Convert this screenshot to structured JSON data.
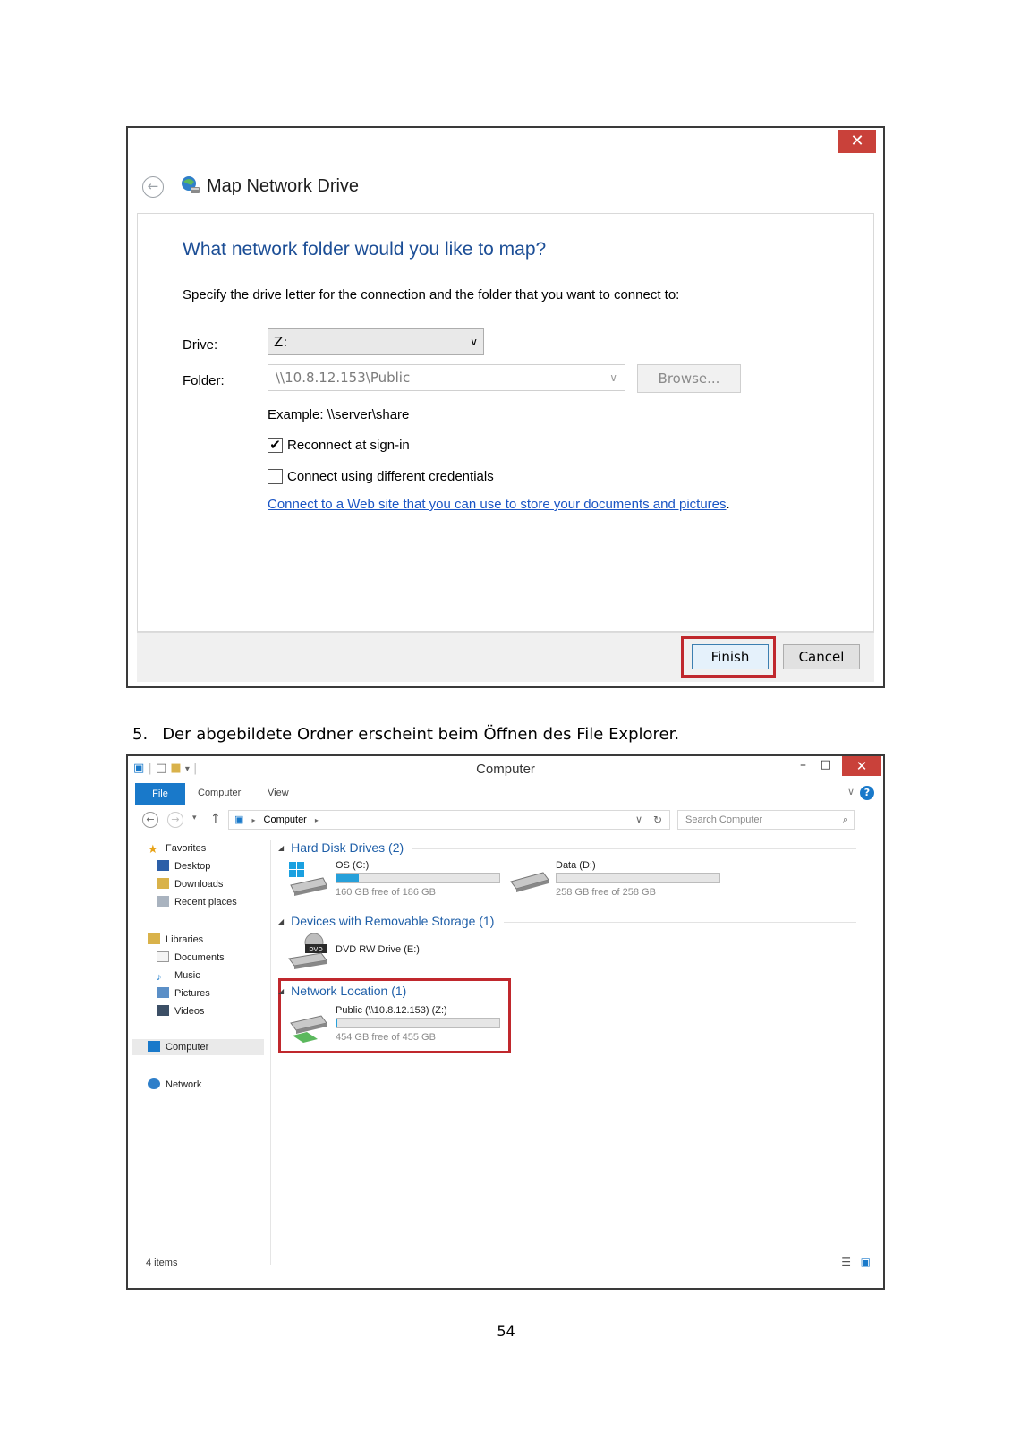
{
  "dialog": {
    "close_glyph": "✕",
    "back_glyph": "←",
    "title": "Map Network Drive",
    "heading": "What network folder would you like to map?",
    "description": "Specify the drive letter for the connection and the folder that you want to connect to:",
    "drive_label": "Drive:",
    "drive_value": "Z:",
    "folder_label": "Folder:",
    "folder_value": "\\\\10.8.12.153\\Public",
    "browse_label": "Browse...",
    "example": "Example: \\\\server\\share",
    "reconnect_label": "Reconnect at sign-in",
    "reconnect_checked": true,
    "credentials_label": "Connect using different credentials",
    "credentials_checked": false,
    "web_link": "Connect to a Web site that you can use to store your documents and pictures",
    "web_link_suffix": ".",
    "finish_label": "Finish",
    "cancel_label": "Cancel",
    "highlight_color": "#c0282d"
  },
  "caption": {
    "number": "5.",
    "text": "Der abgebildete Ordner erscheint beim Öffnen des File Explorer."
  },
  "explorer": {
    "title": "Computer",
    "tabs": [
      "File",
      "Computer",
      "View"
    ],
    "address_location": "Computer",
    "search_placeholder": "Search Computer",
    "sidebar": {
      "favorites": "Favorites",
      "favorites_items": [
        "Desktop",
        "Downloads",
        "Recent places"
      ],
      "libraries": "Libraries",
      "libraries_items": [
        "Documents",
        "Music",
        "Pictures",
        "Videos"
      ],
      "computer": "Computer",
      "network": "Network"
    },
    "groups": {
      "hard_disks": "Hard Disk Drives (2)",
      "removable": "Devices with Removable Storage (1)",
      "network": "Network Location (1)"
    },
    "drives": {
      "os": {
        "name": "OS (C:)",
        "free": "160 GB free of 186 GB",
        "used_fraction": 0.14
      },
      "data": {
        "name": "Data (D:)",
        "free": "258 GB free of 258 GB",
        "used_fraction": 0.0
      },
      "dvd": {
        "name": "DVD RW Drive (E:)"
      },
      "public": {
        "name": "Public (\\\\10.8.12.153) (Z:)",
        "free": "454 GB free of 455 GB",
        "used_fraction": 0.002
      }
    },
    "status": "4 items",
    "accent_color": "#1979ca"
  },
  "page_number": "54"
}
